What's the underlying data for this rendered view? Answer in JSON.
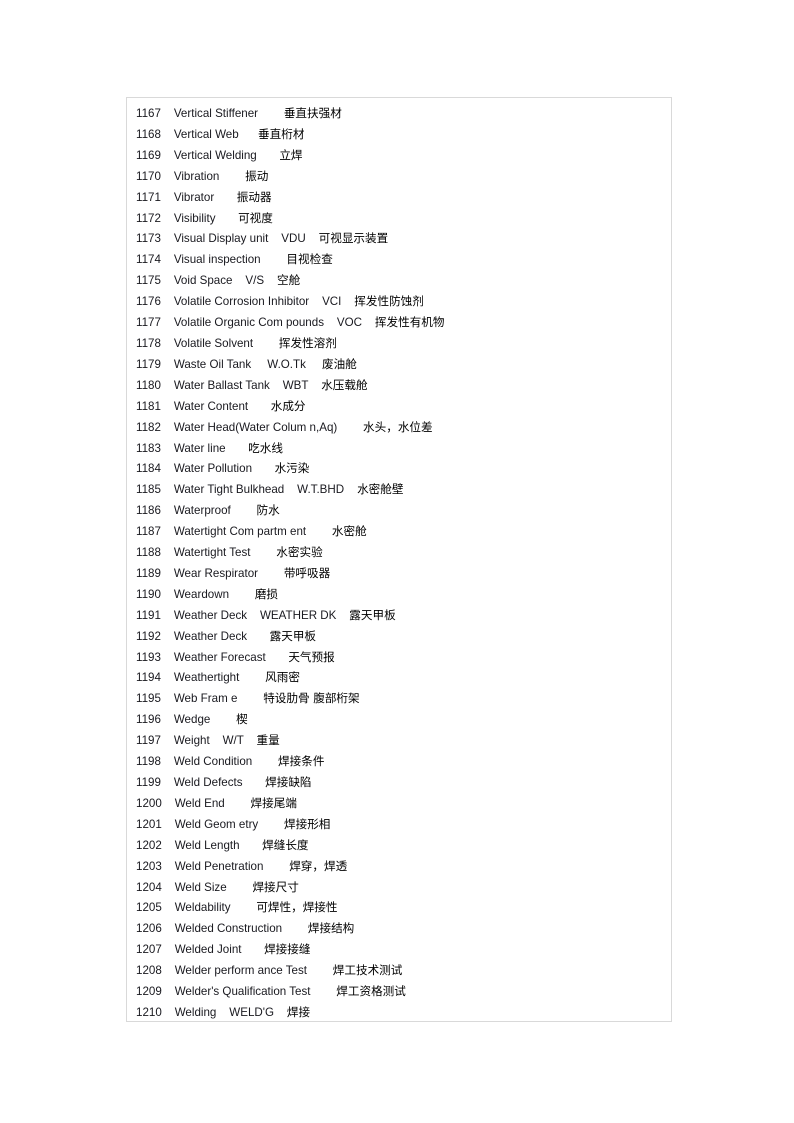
{
  "page": {
    "background_color": "#ffffff",
    "frame_border_color": "#d9d9d9"
  },
  "glossary": {
    "entries": [
      {
        "num": "1167",
        "term": "Vertical Stiffener",
        "gap1": "        ",
        "abbr": "",
        "gap2": "",
        "cn": "垂直扶强材"
      },
      {
        "num": "1168",
        "term": "Vertical Web",
        "gap1": "      ",
        "abbr": "",
        "gap2": "",
        "cn": "垂直桁材"
      },
      {
        "num": "1169",
        "term": "Vertical Welding",
        "gap1": "       ",
        "abbr": "",
        "gap2": "",
        "cn": "立焊"
      },
      {
        "num": "1170",
        "term": "Vibration",
        "gap1": "        ",
        "abbr": "",
        "gap2": "",
        "cn": "振动"
      },
      {
        "num": "1171",
        "term": "Vibrator",
        "gap1": "       ",
        "abbr": "",
        "gap2": "",
        "cn": "振动器"
      },
      {
        "num": "1172",
        "term": "Visibility",
        "gap1": "       ",
        "abbr": "",
        "gap2": "",
        "cn": "可视度"
      },
      {
        "num": "1173",
        "term": "Visual Display unit",
        "gap1": "    ",
        "abbr": "VDU",
        "gap2": "    ",
        "cn": "可视显示装置"
      },
      {
        "num": "1174",
        "term": "Visual inspection",
        "gap1": "        ",
        "abbr": "",
        "gap2": "",
        "cn": "目视检查"
      },
      {
        "num": "1175",
        "term": "Void Space",
        "gap1": "    ",
        "abbr": "V/S",
        "gap2": "    ",
        "cn": "空舱"
      },
      {
        "num": "1176",
        "term": "Volatile Corrosion Inhibitor",
        "gap1": "    ",
        "abbr": "VCI",
        "gap2": "    ",
        "cn": "挥发性防蚀剂"
      },
      {
        "num": "1177",
        "term": "Volatile Organic Com pounds",
        "gap1": "    ",
        "abbr": "VOC",
        "gap2": "    ",
        "cn": "挥发性有机物"
      },
      {
        "num": "1178",
        "term": "Volatile Solvent",
        "gap1": "        ",
        "abbr": "",
        "gap2": "",
        "cn": "挥发性溶剂"
      },
      {
        "num": "1179",
        "term": "Waste Oil Tank",
        "gap1": "     ",
        "abbr": "W.O.Tk",
        "gap2": "     ",
        "cn": "废油舱"
      },
      {
        "num": "1180",
        "term": "Water Ballast Tank",
        "gap1": "    ",
        "abbr": "WBT",
        "gap2": "    ",
        "cn": "水压载舱"
      },
      {
        "num": "1181",
        "term": "Water Content",
        "gap1": "       ",
        "abbr": "",
        "gap2": "",
        "cn": "水成分"
      },
      {
        "num": "1182",
        "term": "Water Head(Water Colum n,Aq)",
        "gap1": "        ",
        "abbr": "",
        "gap2": "",
        "cn": "水头，水位差"
      },
      {
        "num": "1183",
        "term": "Water line",
        "gap1": "       ",
        "abbr": "",
        "gap2": "",
        "cn": "吃水线"
      },
      {
        "num": "1184",
        "term": "Water Pollution",
        "gap1": "       ",
        "abbr": "",
        "gap2": "",
        "cn": "水污染"
      },
      {
        "num": "1185",
        "term": "Water Tight Bulkhead",
        "gap1": "    ",
        "abbr": "W.T.BHD",
        "gap2": "    ",
        "cn": "水密舱壁"
      },
      {
        "num": "1186",
        "term": "Waterproof",
        "gap1": "        ",
        "abbr": "",
        "gap2": "",
        "cn": "防水"
      },
      {
        "num": "1187",
        "term": "Watertight Com partm ent",
        "gap1": "        ",
        "abbr": "",
        "gap2": "",
        "cn": "水密舱"
      },
      {
        "num": "1188",
        "term": "Watertight Test",
        "gap1": "        ",
        "abbr": "",
        "gap2": "",
        "cn": "水密实验"
      },
      {
        "num": "1189",
        "term": "Wear Respirator",
        "gap1": "        ",
        "abbr": "",
        "gap2": "",
        "cn": "带呼吸器"
      },
      {
        "num": "1190",
        "term": "Weardown",
        "gap1": "        ",
        "abbr": "",
        "gap2": "",
        "cn": "磨损"
      },
      {
        "num": "1191",
        "term": "Weather Deck",
        "gap1": "    ",
        "abbr": "WEATHER DK",
        "gap2": "    ",
        "cn": "露天甲板"
      },
      {
        "num": "1192",
        "term": "Weather Deck",
        "gap1": "       ",
        "abbr": "",
        "gap2": "",
        "cn": "露天甲板"
      },
      {
        "num": "1193",
        "term": "Weather Forecast",
        "gap1": "       ",
        "abbr": "",
        "gap2": "",
        "cn": "天气预报"
      },
      {
        "num": "1194",
        "term": "Weathertight",
        "gap1": "        ",
        "abbr": "",
        "gap2": "",
        "cn": "风雨密"
      },
      {
        "num": "1195",
        "term": "Web Fram e",
        "gap1": "        ",
        "abbr": "",
        "gap2": "",
        "cn": "特设肋骨 腹部桁架"
      },
      {
        "num": "1196",
        "term": "Wedge",
        "gap1": "        ",
        "abbr": "",
        "gap2": "",
        "cn": "楔"
      },
      {
        "num": "1197",
        "term": "Weight",
        "gap1": "    ",
        "abbr": "W/T",
        "gap2": "    ",
        "cn": "重量"
      },
      {
        "num": "1198",
        "term": "Weld Condition",
        "gap1": "        ",
        "abbr": "",
        "gap2": "",
        "cn": "焊接条件"
      },
      {
        "num": "1199",
        "term": "Weld Defects",
        "gap1": "       ",
        "abbr": "",
        "gap2": "",
        "cn": "焊接缺陷"
      },
      {
        "num": "1200",
        "term": "Weld End",
        "gap1": "        ",
        "abbr": "",
        "gap2": "",
        "cn": "焊接尾端"
      },
      {
        "num": "1201",
        "term": "Weld Geom etry",
        "gap1": "        ",
        "abbr": "",
        "gap2": "",
        "cn": "焊接形相"
      },
      {
        "num": "1202",
        "term": "Weld Length",
        "gap1": "       ",
        "abbr": "",
        "gap2": "",
        "cn": "焊缝长度"
      },
      {
        "num": "1203",
        "term": "Weld Penetration",
        "gap1": "        ",
        "abbr": "",
        "gap2": "",
        "cn": "焊穿，焊透"
      },
      {
        "num": "1204",
        "term": "Weld Size",
        "gap1": "        ",
        "abbr": "",
        "gap2": "",
        "cn": "焊接尺寸"
      },
      {
        "num": "1205",
        "term": "Weldability",
        "gap1": "        ",
        "abbr": "",
        "gap2": "",
        "cn": "可焊性，焊接性"
      },
      {
        "num": "1206",
        "term": "Welded Construction",
        "gap1": "        ",
        "abbr": "",
        "gap2": "",
        "cn": "焊接结构"
      },
      {
        "num": "1207",
        "term": "Welded Joint",
        "gap1": "       ",
        "abbr": "",
        "gap2": "",
        "cn": "焊接接缝"
      },
      {
        "num": "1208",
        "term": "Welder perform ance Test",
        "gap1": "        ",
        "abbr": "",
        "gap2": "",
        "cn": "焊工技术测试"
      },
      {
        "num": "1209",
        "term": "Welder's Qualification Test",
        "gap1": "        ",
        "abbr": "",
        "gap2": "",
        "cn": "焊工资格测试"
      },
      {
        "num": "1210",
        "term": "Welding",
        "gap1": "    ",
        "abbr": "WELD'G",
        "gap2": "    ",
        "cn": "焊接"
      }
    ]
  }
}
